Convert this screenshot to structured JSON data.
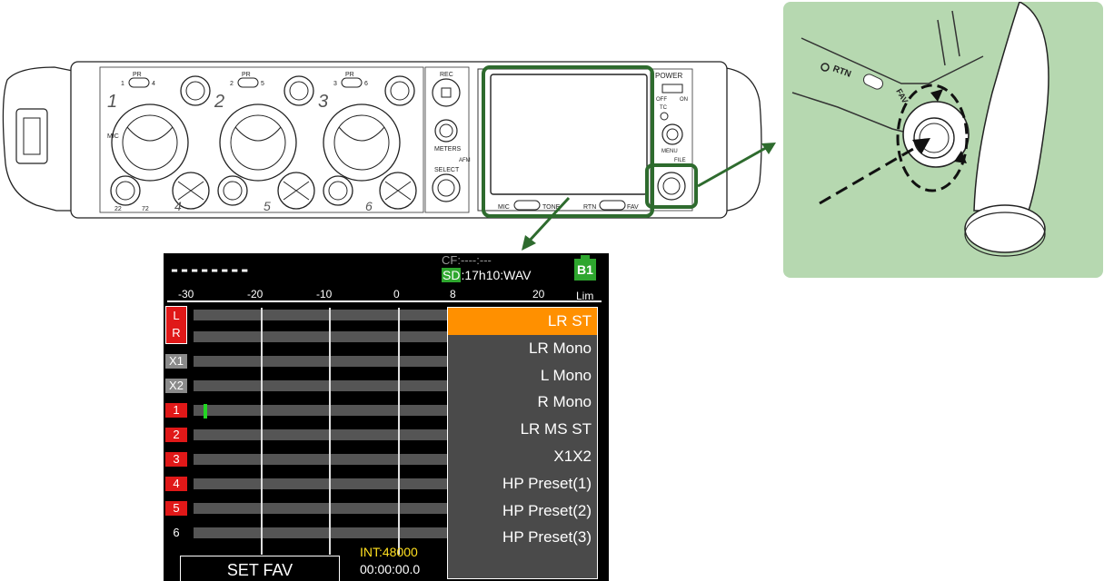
{
  "device": {
    "channel_numbers": [
      "1",
      "2",
      "3",
      "4",
      "5",
      "6"
    ],
    "pair_labels": [
      "PR",
      "1",
      "4",
      "PR",
      "2",
      "5",
      "PR",
      "3",
      "6"
    ],
    "labels": {
      "mic": "MIC",
      "rec": "REC",
      "meters": "METERS",
      "select": "SELECT",
      "afm": "AFM",
      "power": "POWER",
      "off": "OFF",
      "on": "ON",
      "tc": "TC",
      "menu": "MENU",
      "file": "FILE",
      "mic_tone": "MIC",
      "tone": "TONE",
      "rtn": "RTN",
      "fav": "FAV",
      "l": "L",
      "r": "R",
      "zero": "0",
      "knob_22": "22",
      "knob_72": "72"
    }
  },
  "zoom": {
    "rtn_label": "RTN",
    "fav_label": "FAV",
    "bg_color": "#b6d8b0"
  },
  "screen": {
    "top_dashes": "--------",
    "cf_text": "CF:----:---",
    "sd_badge": "SD",
    "sd_text": ":17h10:WAV",
    "battery": "B1",
    "scale_ticks": [
      "-30",
      "-20",
      "-10",
      "0",
      "8",
      "20"
    ],
    "lim": "Lim",
    "channels": [
      {
        "label": "L",
        "style": "lr"
      },
      {
        "label": "R",
        "style": "lr"
      },
      {
        "label": "X1",
        "style": "gray"
      },
      {
        "label": "X2",
        "style": "gray"
      },
      {
        "label": "1",
        "style": "red"
      },
      {
        "label": "2",
        "style": "red"
      },
      {
        "label": "3",
        "style": "red"
      },
      {
        "label": "4",
        "style": "red"
      },
      {
        "label": "5",
        "style": "red"
      },
      {
        "label": "6",
        "style": "plain"
      }
    ],
    "set_fav": "SET FAV",
    "int_rate": "INT:48000",
    "timecode": "00:00:00.0",
    "menu_items": [
      {
        "label": "LR ST",
        "selected": true
      },
      {
        "label": "LR Mono",
        "selected": false
      },
      {
        "label": "L Mono",
        "selected": false
      },
      {
        "label": "R Mono",
        "selected": false
      },
      {
        "label": "LR MS ST",
        "selected": false
      },
      {
        "label": "X1X2",
        "selected": false
      },
      {
        "label": "HP Preset(1)",
        "selected": false
      },
      {
        "label": "HP Preset(2)",
        "selected": false
      },
      {
        "label": "HP Preset(3)",
        "selected": false
      }
    ],
    "colors": {
      "selected": "#ff9000",
      "red_channel": "#e01818",
      "meter_green": "#22d622",
      "sd_green": "#2ea62e",
      "int_yellow": "#ffe020"
    }
  },
  "highlight_color": "#2e6b2e"
}
